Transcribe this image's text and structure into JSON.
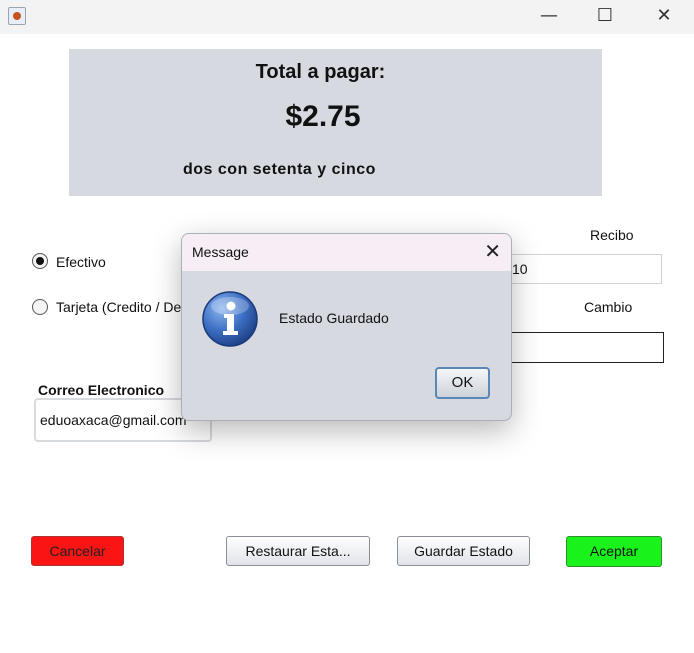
{
  "window": {
    "minimize_glyph": "—",
    "maximize_glyph": "☐",
    "close_glyph": "✕"
  },
  "summary": {
    "total_label": "Total a pagar:",
    "amount": "$2.75",
    "amount_words": "dos con setenta y cinco"
  },
  "payment": {
    "cash_label": "Efectivo",
    "cash_selected": true,
    "card_label": "Tarjeta (Credito / De",
    "card_selected": false,
    "receipt_label": "Recibo",
    "receipt_value": "10",
    "change_label": "Cambio",
    "change_value": ""
  },
  "email": {
    "label": "Correo Electronico",
    "value": "eduoaxaca@gmail.com"
  },
  "buttons": {
    "cancel": "Cancelar",
    "restore": "Restaurar Esta...",
    "save": "Guardar Estado",
    "accept": "Aceptar"
  },
  "dialog": {
    "title": "Message",
    "message": "Estado Guardado",
    "ok_label": "OK",
    "close_glyph": "✕",
    "icon": "info-icon"
  },
  "colors": {
    "cancel_bg": "#fb1414",
    "accept_bg": "#19f31b",
    "panel_bg": "#d6d9e0"
  }
}
